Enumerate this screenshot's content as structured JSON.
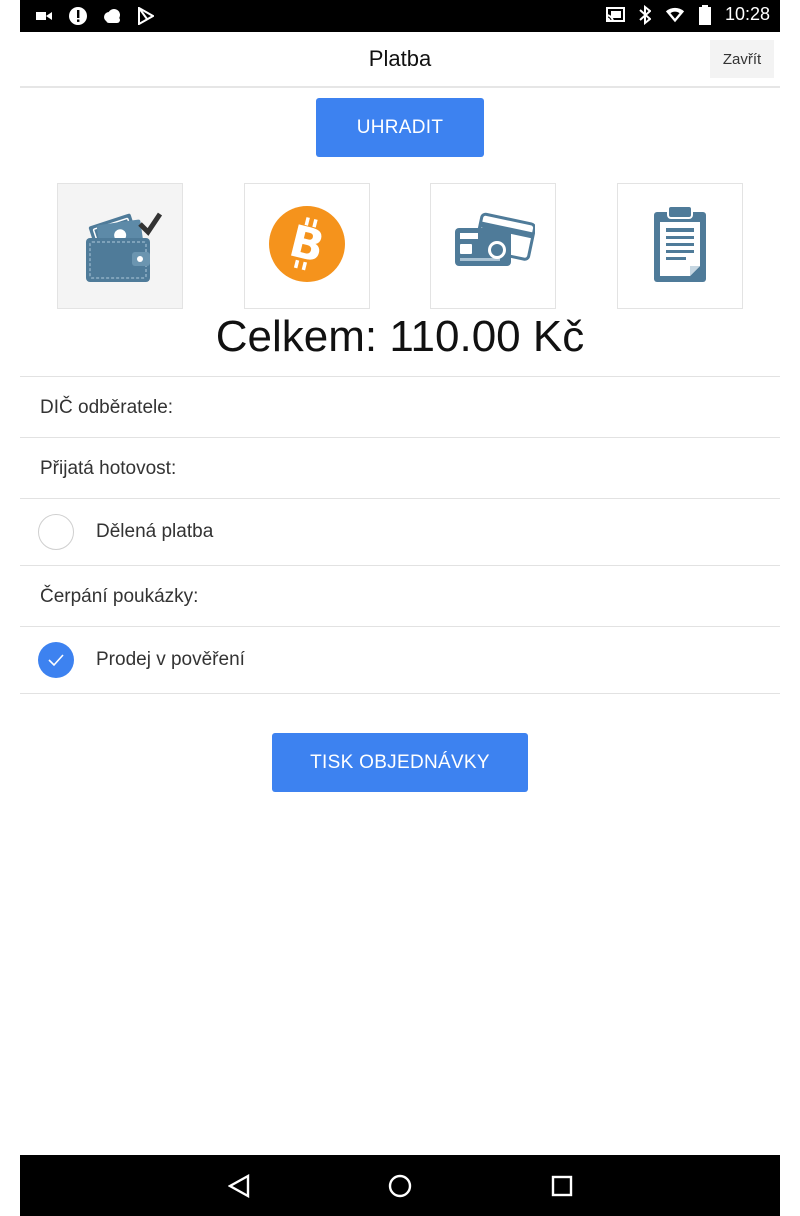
{
  "status_bar": {
    "time": "10:28",
    "left_icons": [
      "video-icon",
      "alert-icon",
      "cloud-icon",
      "play-store-icon"
    ],
    "right_icons": [
      "cast-icon",
      "bluetooth-icon",
      "wifi-icon",
      "battery-icon"
    ]
  },
  "header": {
    "title": "Platba",
    "close_label": "Zavřít"
  },
  "actions": {
    "pay_label": "UHRADIT",
    "print_label": "TISK OBJEDNÁVKY"
  },
  "payment_methods": [
    {
      "name": "wallet-icon",
      "selected": true
    },
    {
      "name": "bitcoin-icon",
      "selected": false
    },
    {
      "name": "card-icon",
      "selected": false
    },
    {
      "name": "invoice-icon",
      "selected": false
    }
  ],
  "total": "Celkem: 110.00 Kč",
  "form": {
    "dic_label": "DIČ odběratele:",
    "cash_label": "Přijatá hotovost:",
    "split_label": "Dělená platba",
    "split_checked": false,
    "voucher_label": "Čerpání poukázky:",
    "consignment_label": "Prodej v pověření",
    "consignment_checked": true
  },
  "nav_bar": {
    "icons": [
      "back-icon",
      "home-icon",
      "recents-icon"
    ]
  },
  "colors": {
    "accent": "#3d82f0",
    "bitcoin": "#f5931c",
    "icon_slate": "#4f7b99"
  }
}
